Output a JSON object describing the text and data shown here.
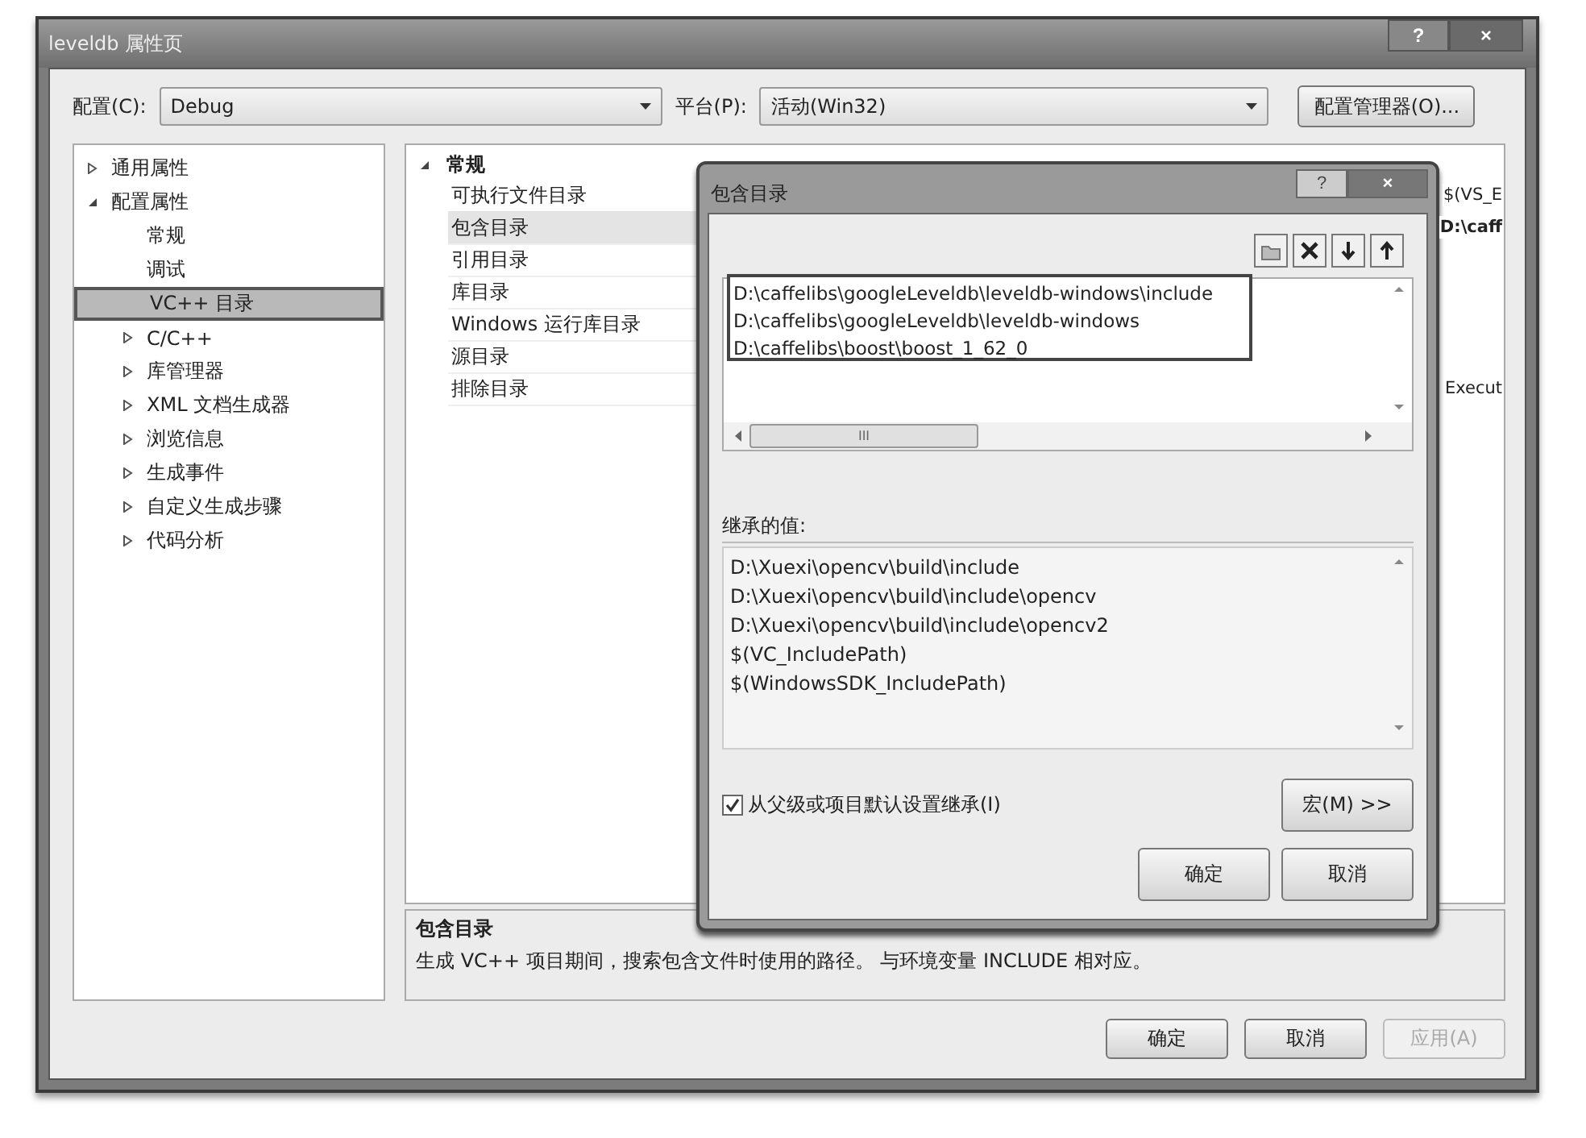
{
  "window": {
    "title": "leveldb 属性页",
    "help_button": "?",
    "close_button": "×"
  },
  "config": {
    "label": "配置(C):",
    "value": "Debug"
  },
  "platform": {
    "label": "平台(P):",
    "value": "活动(Win32)"
  },
  "config_manager_button": "配置管理器(O)...",
  "tree": [
    {
      "label": "通用属性",
      "expanded": false,
      "selected": false
    },
    {
      "label": "配置属性",
      "expanded": true,
      "selected": false,
      "children": [
        {
          "label": "常规",
          "selected": false
        },
        {
          "label": "调试",
          "selected": false
        },
        {
          "label": "VC++ 目录",
          "selected": true
        },
        {
          "label": "C/C++",
          "expanded": false,
          "selected": false
        },
        {
          "label": "库管理器",
          "expanded": false,
          "selected": false
        },
        {
          "label": "XML 文档生成器",
          "expanded": false,
          "selected": false
        },
        {
          "label": "浏览信息",
          "expanded": false,
          "selected": false
        },
        {
          "label": "生成事件",
          "expanded": false,
          "selected": false
        },
        {
          "label": "自定义生成步骤",
          "expanded": false,
          "selected": false
        },
        {
          "label": "代码分析",
          "expanded": false,
          "selected": false
        }
      ]
    }
  ],
  "property_grid": {
    "category": "常规",
    "expanded": true,
    "rows": [
      {
        "name": "可执行文件目录",
        "value": "$(VS_E",
        "modified": false,
        "selected": false
      },
      {
        "name": "包含目录",
        "value": "D:\\caff",
        "modified": true,
        "selected": true
      },
      {
        "name": "引用目录",
        "selected": false
      },
      {
        "name": "库目录",
        "selected": false
      },
      {
        "name": "Windows 运行库目录",
        "selected": false
      },
      {
        "name": "源目录",
        "selected": false
      },
      {
        "name": "排除目录",
        "value": "Execut",
        "modified": false,
        "selected": false
      }
    ]
  },
  "description": {
    "title": "包含目录",
    "text": "生成 VC++ 项目期间，搜索包含文件时使用的路径。 与环境变量 INCLUDE 相对应。"
  },
  "buttons": [
    {
      "label": "确定",
      "disabled": false
    },
    {
      "label": "取消",
      "disabled": false
    },
    {
      "label": "应用(A)",
      "disabled": true
    }
  ],
  "dialog": {
    "title": "包含目录",
    "help_button": "?",
    "close_button": "×",
    "toolbar": [
      {
        "kind": "folder"
      },
      {
        "kind": "delete"
      },
      {
        "kind": "down"
      },
      {
        "kind": "up"
      }
    ],
    "entries": [
      "D:\\caffelibs\\googleLeveldb\\leveldb-windows\\include",
      "D:\\caffelibs\\googleLeveldb\\leveldb-windows",
      "D:\\caffelibs\\boost\\boost_1_62_0"
    ],
    "h_scroll_grip": "III",
    "inherited_label": "继承的值:",
    "inherited": [
      "D:\\Xuexi\\opencv\\build\\include",
      "D:\\Xuexi\\opencv\\build\\include\\opencv",
      "D:\\Xuexi\\opencv\\build\\include\\opencv2",
      "$(VC_IncludePath)",
      "$(WindowsSDK_IncludePath)"
    ],
    "inherit_checkbox": {
      "label": "从父级或项目默认设置继承(I)",
      "checked": true
    },
    "macro_button": "宏(M) >>",
    "buttons": [
      "确定",
      "取消"
    ]
  }
}
